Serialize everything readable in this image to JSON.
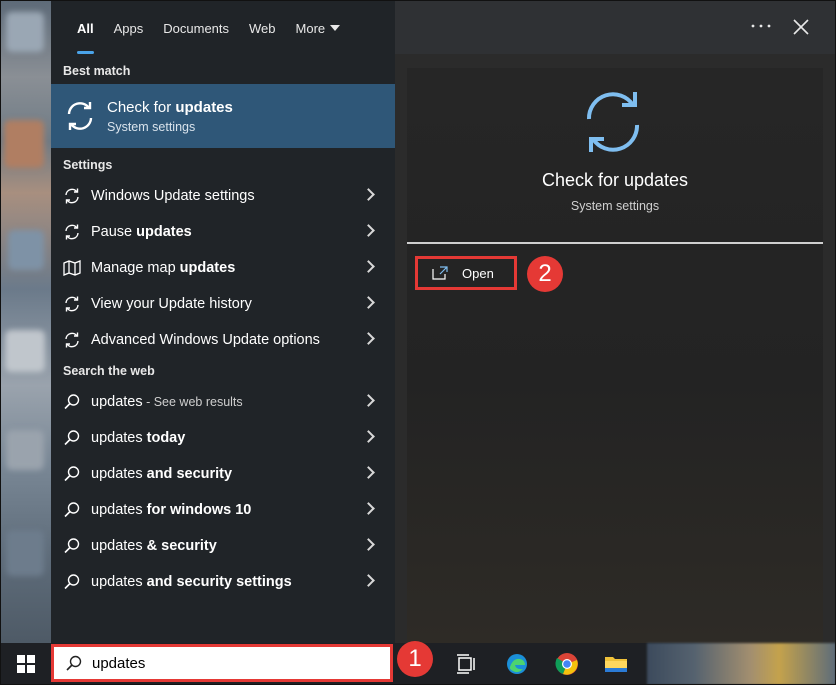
{
  "tabs": [
    {
      "label": "All"
    },
    {
      "label": "Apps"
    },
    {
      "label": "Documents"
    },
    {
      "label": "Web"
    },
    {
      "label": "More"
    }
  ],
  "sections": {
    "best_match": "Best match",
    "settings": "Settings",
    "search_web": "Search the web"
  },
  "best_match": {
    "title_pre": "Check for ",
    "title_bold": "updates",
    "subtitle": "System settings"
  },
  "settings_items": [
    {
      "pre": "Windows Update settings",
      "bold": "",
      "post": ""
    },
    {
      "pre": "Pause ",
      "bold": "updates",
      "post": ""
    },
    {
      "pre": "Manage map ",
      "bold": "updates",
      "post": ""
    },
    {
      "pre": "View your Update history",
      "bold": "",
      "post": ""
    },
    {
      "pre": "Advanced Windows Update options",
      "bold": "",
      "post": ""
    }
  ],
  "web_items": [
    {
      "pre": "updates",
      "bold": "",
      "post": " - See web results"
    },
    {
      "pre": "updates ",
      "bold": "today",
      "post": ""
    },
    {
      "pre": "updates ",
      "bold": "and security",
      "post": ""
    },
    {
      "pre": "updates ",
      "bold": "for windows 10",
      "post": ""
    },
    {
      "pre": "updates ",
      "bold": "& security",
      "post": ""
    },
    {
      "pre": "updates ",
      "bold": "and security settings",
      "post": ""
    }
  ],
  "preview": {
    "title": "Check for updates",
    "subtitle": "System settings",
    "open_label": "Open"
  },
  "search": {
    "value": "updates"
  },
  "badges": {
    "one": "1",
    "two": "2"
  },
  "icons": {
    "more": "more-dots-icon",
    "close": "close-icon",
    "sync": "sync-icon",
    "map": "map-icon",
    "search": "search-icon",
    "open": "open-external-icon",
    "start": "windows-start-icon",
    "task_view": "task-view-icon",
    "edge": "edge-browser-icon",
    "chrome": "chrome-browser-icon",
    "explorer": "file-explorer-icon"
  },
  "colors": {
    "accent": "#4aa3e8",
    "selected_row": "#2f5778",
    "highlight": "#e53935",
    "sync_blue": "#7fbef0"
  }
}
